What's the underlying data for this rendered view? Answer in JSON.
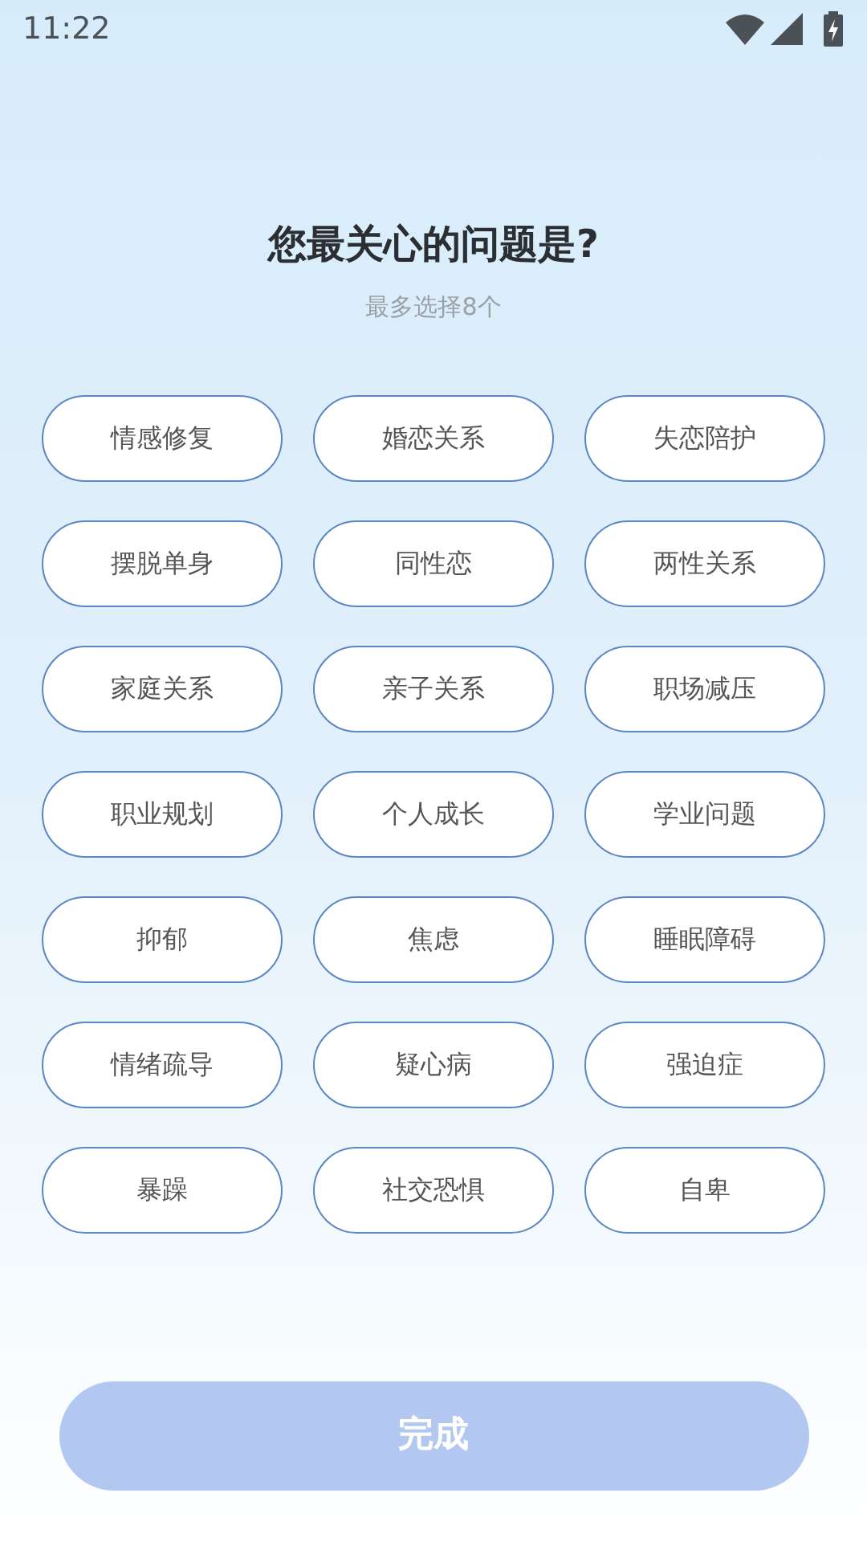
{
  "status_bar": {
    "time": "11:22"
  },
  "title": "您最关心的问题是?",
  "subtitle": "最多选择8个",
  "options": [
    {
      "label": "情感修复",
      "selected": false
    },
    {
      "label": "婚恋关系",
      "selected": false
    },
    {
      "label": "失恋陪护",
      "selected": false
    },
    {
      "label": "摆脱单身",
      "selected": false
    },
    {
      "label": "同性恋",
      "selected": false
    },
    {
      "label": "两性关系",
      "selected": false
    },
    {
      "label": "家庭关系",
      "selected": false
    },
    {
      "label": "亲子关系",
      "selected": false
    },
    {
      "label": "职场减压",
      "selected": false
    },
    {
      "label": "职业规划",
      "selected": false
    },
    {
      "label": "个人成长",
      "selected": false
    },
    {
      "label": "学业问题",
      "selected": false
    },
    {
      "label": "抑郁",
      "selected": false
    },
    {
      "label": "焦虑",
      "selected": false
    },
    {
      "label": "睡眠障碍",
      "selected": false
    },
    {
      "label": "情绪疏导",
      "selected": false
    },
    {
      "label": "疑心病",
      "selected": false
    },
    {
      "label": "强迫症",
      "selected": false
    },
    {
      "label": "暴躁",
      "selected": false
    },
    {
      "label": "社交恐惧",
      "selected": false
    },
    {
      "label": "自卑",
      "selected": false
    }
  ],
  "done_button": {
    "label": "完成",
    "disabled": true
  }
}
